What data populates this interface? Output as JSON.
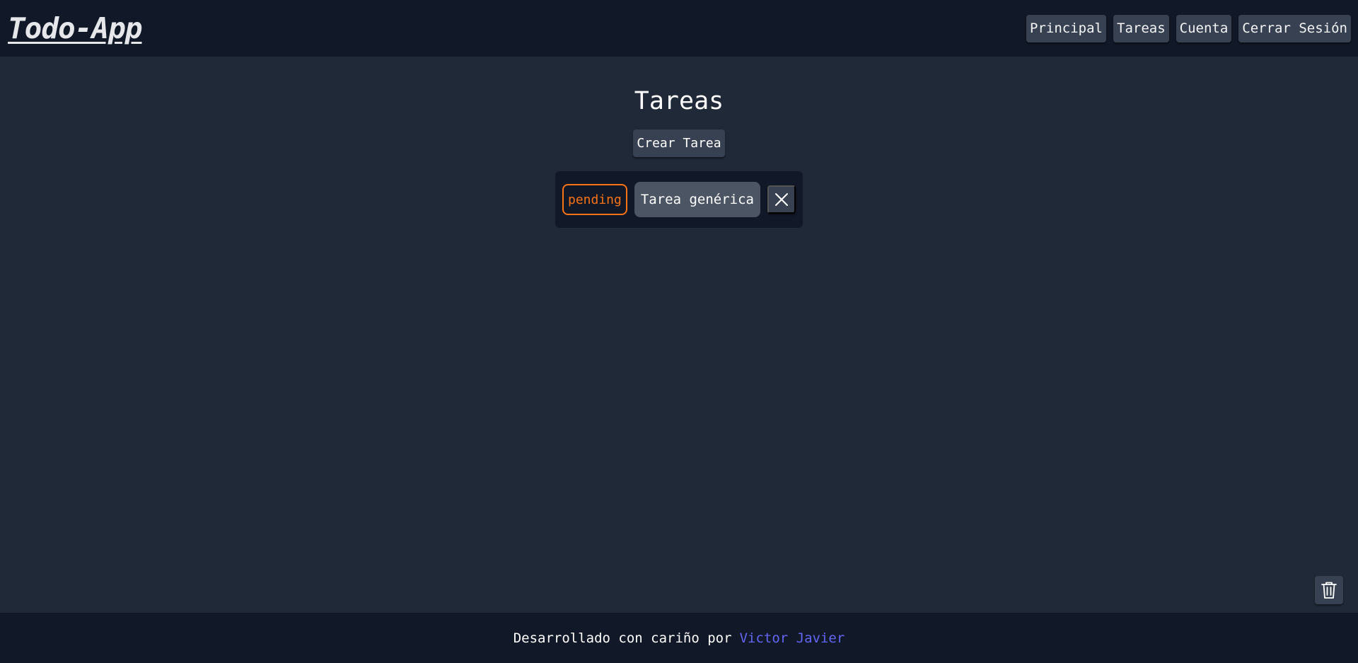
{
  "header": {
    "logo": "Todo-App",
    "nav": [
      {
        "label": "Principal"
      },
      {
        "label": "Tareas"
      },
      {
        "label": "Cuenta"
      },
      {
        "label": "Cerrar Sesión"
      }
    ]
  },
  "main": {
    "title": "Tareas",
    "create_button": "Crear Tarea",
    "tasks": [
      {
        "status": "pending",
        "title": "Tarea genérica",
        "close_icon": "close-icon"
      }
    ],
    "trash_icon": "trash-icon"
  },
  "footer": {
    "text": "Desarrollado con cariño por",
    "author": "Victor Javier"
  },
  "colors": {
    "background": "#1f2937",
    "header_footer": "#111827",
    "button": "#374151",
    "task_title_bg": "#4b5563",
    "pending": "#f97316",
    "link": "#6366f1"
  }
}
